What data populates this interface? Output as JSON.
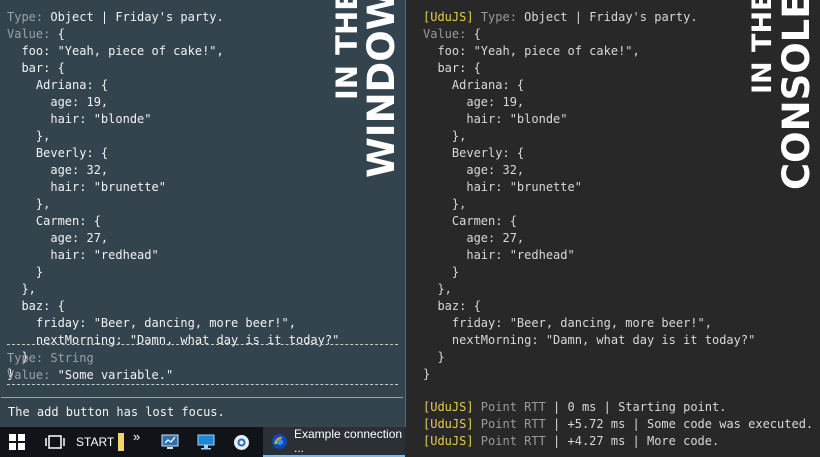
{
  "window_panel": {
    "banner_top": "IN THE",
    "banner_bottom": "WINDOW",
    "object_type_label": "Type:",
    "object_type_value": "Object | Friday's party.",
    "value_label": "Value:",
    "dump": [
      " {",
      "  foo: \"Yeah, piece of cake!\",",
      "  bar: {",
      "    Adriana: {",
      "      age: 19,",
      "      hair: \"blonde\"",
      "    },",
      "    Beverly: {",
      "      age: 32,",
      "      hair: \"brunette\"",
      "    },",
      "    Carmen: {",
      "      age: 27,",
      "      hair: \"redhead\"",
      "    }",
      "  },",
      "  baz: {",
      "    friday: \"Beer, dancing, more beer!\",",
      "    nextMorning: \"Damn, what day is it today?\"",
      "  }",
      "}"
    ],
    "string_type_label": "Type: String",
    "string_value_label": "Value:",
    "string_value": "\"Some variable.\"",
    "status": "The add button has lost focus."
  },
  "console_panel": {
    "banner_top": "IN THE",
    "banner_bottom": "CONSOLE",
    "tag": "[UduJS]",
    "object_type_label": "Type:",
    "object_type_value": "Object | Friday's party.",
    "value_label": "Value:",
    "dump": [
      " {",
      "  foo: \"Yeah, piece of cake!\",",
      "  bar: {",
      "    Adriana: {",
      "      age: 19,",
      "      hair: \"blonde\"",
      "    },",
      "    Beverly: {",
      "      age: 32,",
      "      hair: \"brunette\"",
      "    },",
      "    Carmen: {",
      "      age: 27,",
      "      hair: \"redhead\"",
      "    }",
      "  },",
      "  baz: {",
      "    friday: \"Beer, dancing, more beer!\",",
      "    nextMorning: \"Damn, what day is it today?\"",
      "  }",
      "}"
    ],
    "log": [
      {
        "tag": "[UduJS]",
        "label": " Point RTT",
        "text": " | 0 ms | Starting point."
      },
      {
        "tag": "[UduJS]",
        "label": " Point RTT",
        "text": " | +5.72 ms | Some code was executed."
      },
      {
        "tag": "[UduJS]",
        "label": " Point RTT",
        "text": " | +4.27 ms | More code."
      }
    ]
  },
  "taskbar": {
    "start_label": "START",
    "chevron": "»",
    "task_label": "Example connection ..."
  }
}
